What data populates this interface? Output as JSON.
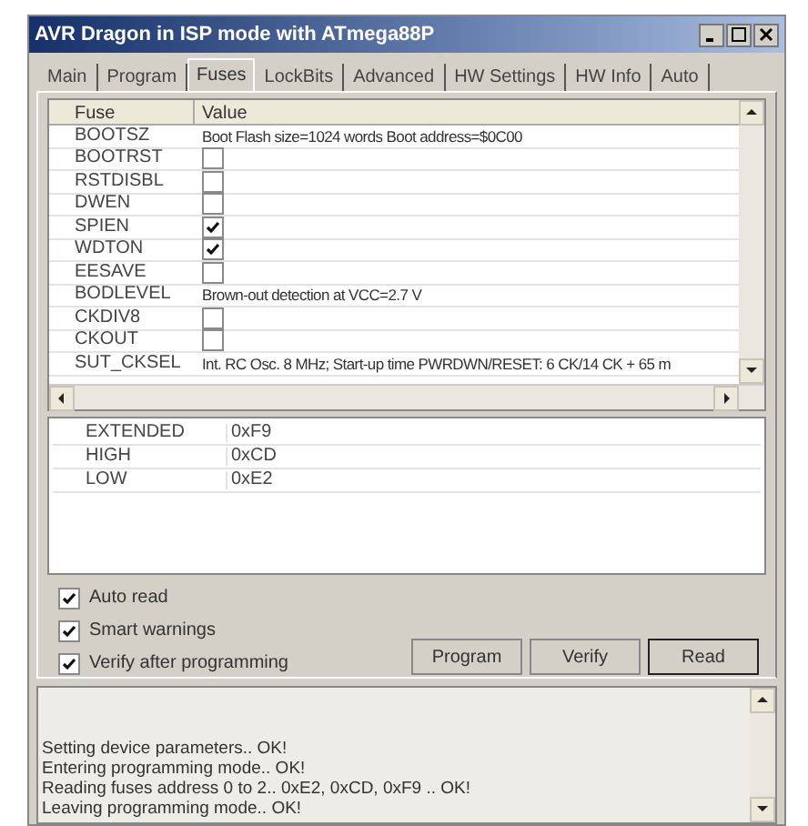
{
  "window": {
    "title": "AVR Dragon in ISP mode with ATmega88P"
  },
  "tabs": [
    {
      "label": "Main",
      "selected": false
    },
    {
      "label": "Program",
      "selected": false
    },
    {
      "label": "Fuses",
      "selected": true
    },
    {
      "label": "LockBits",
      "selected": false
    },
    {
      "label": "Advanced",
      "selected": false
    },
    {
      "label": "HW Settings",
      "selected": false
    },
    {
      "label": "HW Info",
      "selected": false
    },
    {
      "label": "Auto",
      "selected": false
    }
  ],
  "fuse_table": {
    "columns": [
      "Fuse",
      "Value"
    ],
    "rows": [
      {
        "name": "BOOTSZ",
        "kind": "text",
        "value": "Boot Flash size=1024 words Boot address=$0C00"
      },
      {
        "name": "BOOTRST",
        "kind": "checkbox",
        "checked": false
      },
      {
        "name": "RSTDISBL",
        "kind": "checkbox",
        "checked": false
      },
      {
        "name": "DWEN",
        "kind": "checkbox",
        "checked": false
      },
      {
        "name": "SPIEN",
        "kind": "checkbox",
        "checked": true
      },
      {
        "name": "WDTON",
        "kind": "checkbox",
        "checked": true
      },
      {
        "name": "EESAVE",
        "kind": "checkbox",
        "checked": false
      },
      {
        "name": "BODLEVEL",
        "kind": "text",
        "value": "Brown-out detection at VCC=2.7 V"
      },
      {
        "name": "CKDIV8",
        "kind": "checkbox",
        "checked": false
      },
      {
        "name": "CKOUT",
        "kind": "checkbox",
        "checked": false
      },
      {
        "name": "SUT_CKSEL",
        "kind": "text",
        "value": "Int. RC Osc. 8 MHz; Start-up time PWRDWN/RESET: 6 CK/14 CK + 65 m"
      }
    ]
  },
  "register_table": [
    {
      "name": "EXTENDED",
      "value": "0xF9"
    },
    {
      "name": "HIGH",
      "value": "0xCD"
    },
    {
      "name": "LOW",
      "value": "0xE2"
    }
  ],
  "options": [
    {
      "label": "Auto read",
      "checked": true
    },
    {
      "label": "Smart warnings",
      "checked": true
    },
    {
      "label": "Verify after programming",
      "checked": true
    }
  ],
  "buttons": [
    "Program",
    "Verify",
    "Read"
  ],
  "log": [
    "Setting device parameters.. OK!",
    "Entering programming mode.. OK!",
    "Reading fuses address 0 to 2.. 0xE2, 0xCD, 0xF9 .. OK!",
    "Leaving programming mode.. OK!"
  ]
}
